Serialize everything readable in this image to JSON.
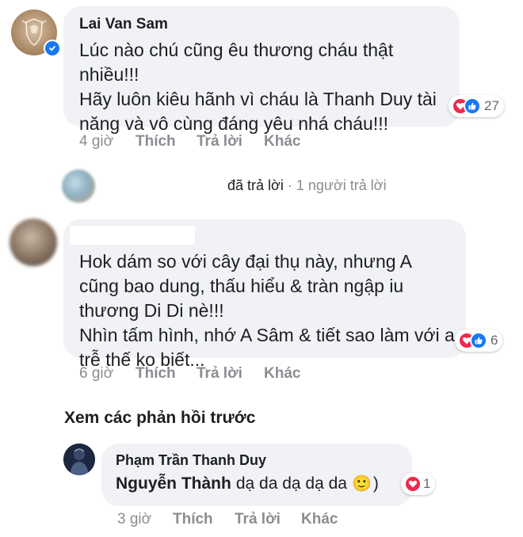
{
  "comments": [
    {
      "author": "Lai Van Sam",
      "lines": [
        "Lúc nào chú cũng êu thương cháu thật",
        "nhiều!!!",
        "Hãy luôn kiêu hãnh vì cháu là Thanh Duy tài",
        "năng và vô cùng đáng yêu nhá cháu!!!"
      ],
      "reaction_count": "27",
      "time": "4 giờ",
      "like_label": "Thích",
      "reply_label": "Trả lời",
      "more_label": "Khác"
    },
    {
      "author": "",
      "lines": [
        "Hok dám so với cây đại thụ này, nhưng A",
        "cũng bao dung, thấu hiểu & tràn ngập iu",
        "thương Di Di nè!!!",
        "Nhìn tấm hình, nhớ A Sâm & tiết sao làm với a",
        "trễ thế ko biết..."
      ],
      "reaction_count": "6",
      "time": "6 giờ",
      "like_label": "Thích",
      "reply_label": "Trả lời",
      "more_label": "Khác"
    }
  ],
  "reply_summary": {
    "replied": "đã trả lời",
    "separator": "·",
    "count_text": "1 người trả lời"
  },
  "view_previous": "Xem các phản hồi trước",
  "reply": {
    "author": "Phạm Trần Thanh Duy",
    "mention": "Nguyễn Thành",
    "text": "dạ da dạ dạ da",
    "emoji": "🙂",
    "paren": ")",
    "reaction_count": "1",
    "time": "3 giờ",
    "like_label": "Thích",
    "reply_label": "Trả lời",
    "more_label": "Khác"
  },
  "colors": {
    "bubble": "#f0f2f5",
    "heart": "#f0284a",
    "like": "#1877f2",
    "meta": "#8a8d91"
  }
}
